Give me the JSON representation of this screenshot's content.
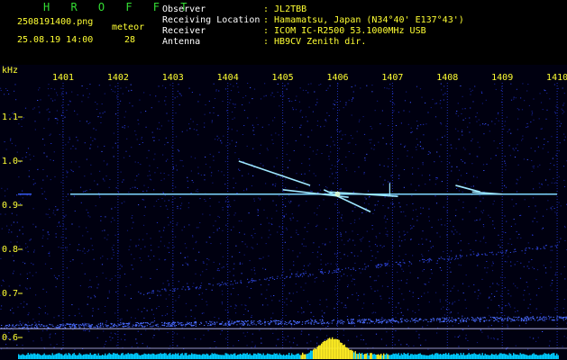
{
  "app": {
    "title": "H R O F F T"
  },
  "file": {
    "name": "2508191400.png",
    "datetime": "25.08.19 14:00"
  },
  "meteor": {
    "label": "meteor",
    "count": "28"
  },
  "info": [
    {
      "key": "Observer",
      "value": ": JL2TBB"
    },
    {
      "key": "Receiving Location",
      "value": ": Hamamatsu, Japan (N34°40' E137°43')"
    },
    {
      "key": "Receiver",
      "value": ": ICOM IC-R2500 53.1000MHz USB"
    },
    {
      "key": "Antenna",
      "value": ": HB9CV Zenith dir."
    }
  ],
  "axes": {
    "unit": "kHz",
    "time_ticks": [
      "1401",
      "1402",
      "1403",
      "1404",
      "1405",
      "1406",
      "1407",
      "1408",
      "1409",
      "1410"
    ],
    "freq_ticks": [
      "1.1",
      "1.0",
      "0.9",
      "0.8",
      "0.7",
      "0.6"
    ]
  },
  "colors": {
    "background": "#000010",
    "noise": "#1a2bb0",
    "carrier": "#7fd8ff",
    "meteor_trail": "#9fe8ff",
    "level_cyan": "#00ccff",
    "level_yellow": "#ffee22",
    "text_yellow": "#ffff33",
    "text_green": "#33dd33"
  }
}
